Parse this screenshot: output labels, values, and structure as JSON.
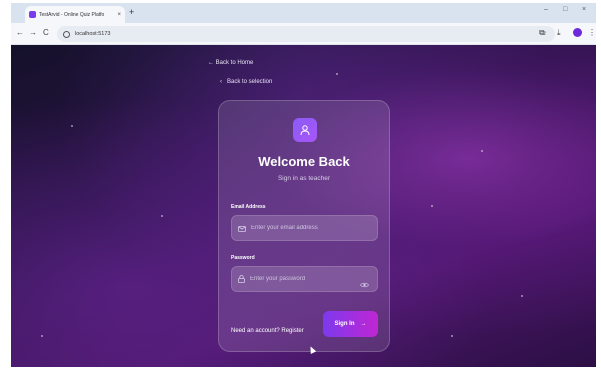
{
  "browser": {
    "tab_title": "TestArvid - Online Quiz Platfo",
    "tab_close": "×",
    "new_tab": "+",
    "minimize": "–",
    "maximize": "□",
    "close": "×",
    "back": "←",
    "forward": "→",
    "reload": "C",
    "url": "localhost:5173",
    "bookmark_glyph": "☆",
    "extensions_glyph": "⧉",
    "download_glyph": "⤓",
    "menu_glyph": "⋮"
  },
  "page": {
    "back_home": "← Back to Home",
    "back_selection_chevron": "‹",
    "back_selection": "Back to selection",
    "card": {
      "title": "Welcome Back",
      "subtitle": "Sign in as teacher",
      "email_label": "Email Address",
      "email_placeholder": "Enter your email address",
      "email_value": "",
      "password_label": "Password",
      "password_placeholder": "Enter your password",
      "password_value": "",
      "register_text": "Need an account? Register",
      "signin_label": "Sign In",
      "signin_arrow": "→"
    }
  },
  "colors": {
    "accent": "#7c3aed",
    "accent_end": "#c026d3",
    "background_dark": "#15112a"
  }
}
